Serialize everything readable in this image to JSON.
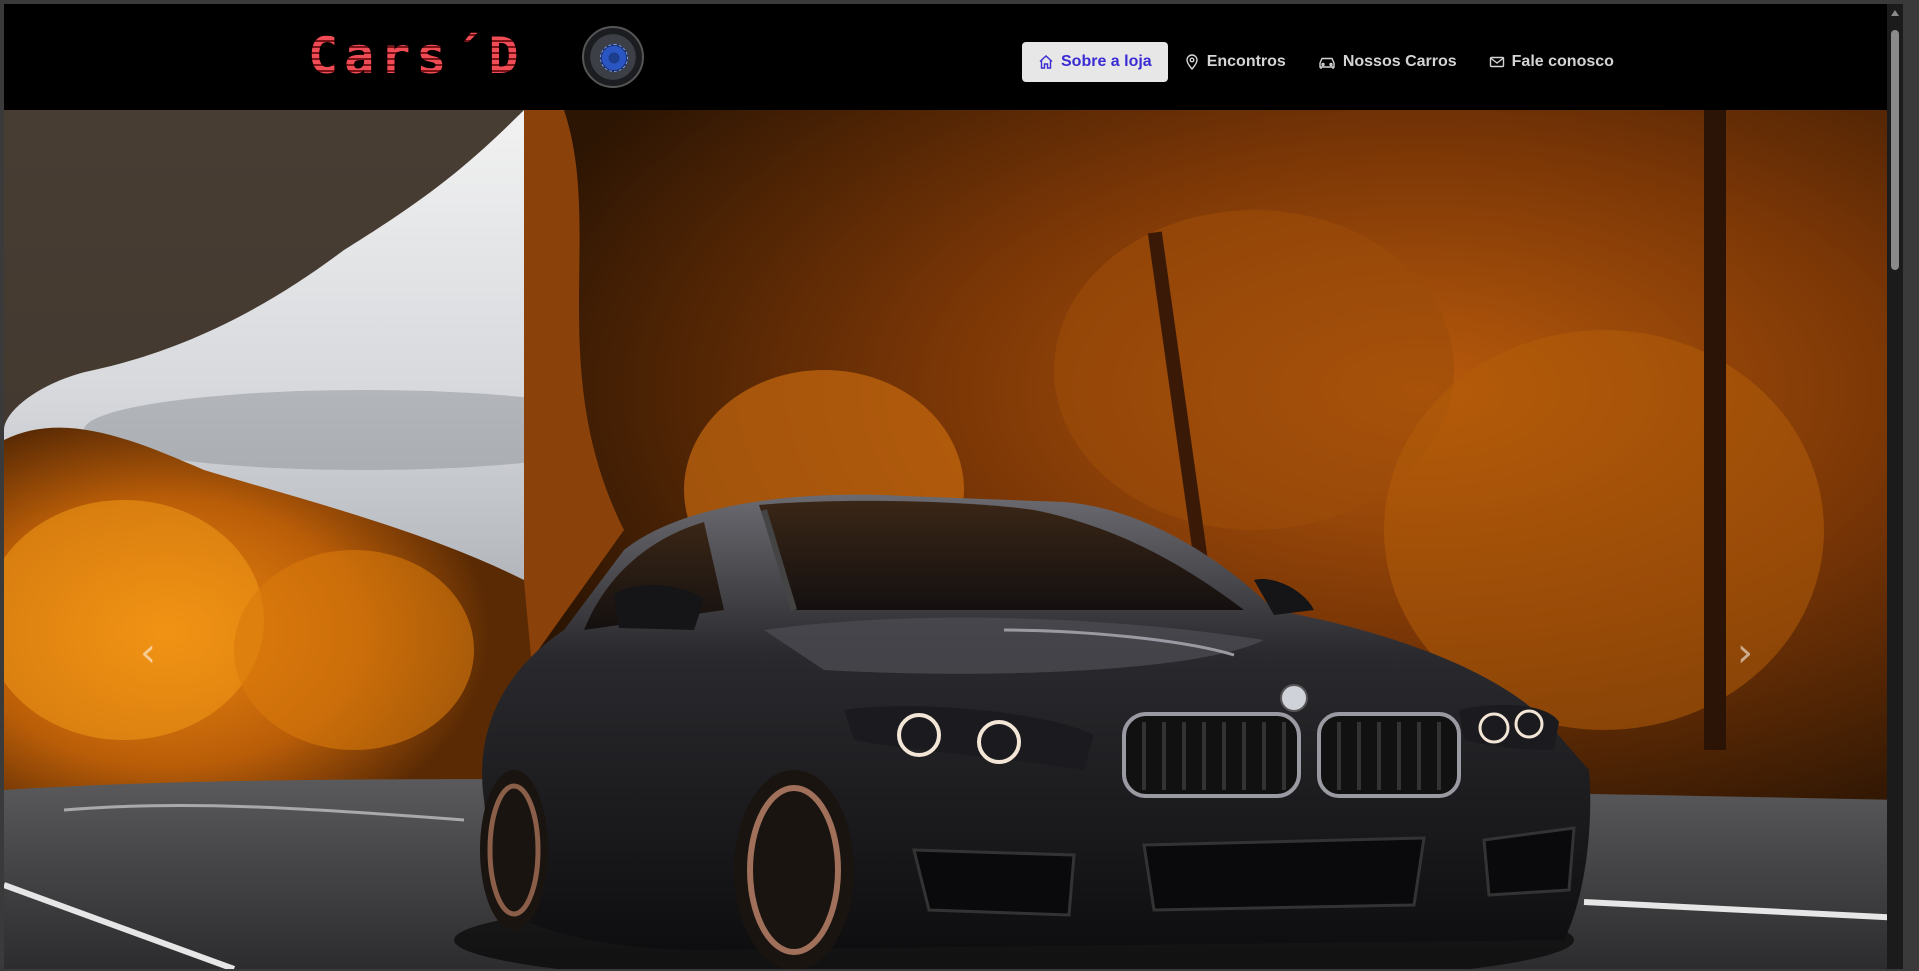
{
  "brand": {
    "name": "Cars´D",
    "logo_icon": "wheel-logo-icon"
  },
  "nav": {
    "items": [
      {
        "label": "Sobre a loja",
        "icon": "home-icon",
        "active": true
      },
      {
        "label": "Encontros",
        "icon": "map-pin-icon",
        "active": false
      },
      {
        "label": "Nossos Carros",
        "icon": "car-icon",
        "active": false
      },
      {
        "label": "Fale conosco",
        "icon": "envelope-icon",
        "active": false
      }
    ]
  },
  "hero": {
    "prev_glyph": "‹",
    "next_glyph": "›"
  },
  "colors": {
    "navbar_bg": "#000000",
    "brand_red": "#e8404a",
    "active_nav_bg": "#e7e7e7",
    "active_nav_text": "#3a2bd4",
    "nav_text": "#d4d4d4"
  }
}
